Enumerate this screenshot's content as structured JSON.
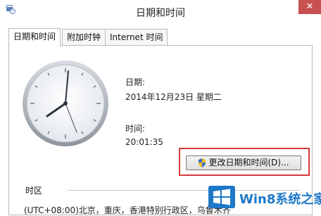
{
  "window": {
    "title": "日期和时间",
    "close_label": "✕"
  },
  "tabs": [
    {
      "label": "日期和时间",
      "active": true
    },
    {
      "label": "附加时钟",
      "active": false
    },
    {
      "label": "Internet 时间",
      "active": false
    }
  ],
  "main": {
    "date_label": "日期:",
    "date_value": "2014年12月23日 星期二",
    "time_label": "时间:",
    "time_value": "20:01:35",
    "change_button_label": "更改日期和时间(D)...",
    "timezone_label": "时区",
    "timezone_value": "(UTC+08:00)北京，重庆，香港特别行政区，乌鲁木齐"
  },
  "watermark": {
    "text": "Win8系统之家"
  },
  "colors": {
    "highlight": "#d43a3a",
    "watermark": "#1e78c8",
    "close": "#c75050"
  },
  "icons": [
    "datetime-app-icon",
    "uac-shield-icon",
    "windows-logo-icon",
    "close-icon"
  ]
}
